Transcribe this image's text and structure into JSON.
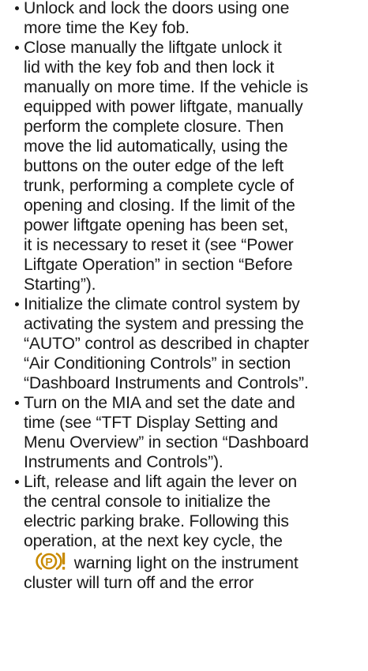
{
  "items": [
    {
      "lines": [
        "Unlock and lock the doors using one",
        "more time the Key fob."
      ]
    },
    {
      "lines": [
        "Close manually the liftgate unlock it",
        "lid with the key fob and then lock it",
        "manually on more time. If the vehicle is",
        "equipped with power liftgate, manually",
        "perform the complete closure. Then",
        "move the lid automatically, using the",
        "buttons on the outer edge of the left",
        "trunk, performing a complete cycle of",
        "opening and closing. If the limit of the",
        "power liftgate opening has been set,",
        "it is necessary to reset it (see “Power",
        "Liftgate Operation” in section “Before",
        "Starting”)."
      ]
    },
    {
      "lines": [
        "Initialize the climate control system by",
        "activating the system and pressing the",
        "“AUTO” control as described in chapter",
        "“Air Conditioning Controls” in section",
        "“Dashboard Instruments and Controls”."
      ]
    },
    {
      "lines": [
        "Turn on the MIA and set the date and",
        "time (see “TFT Display Setting and",
        "Menu Overview” in section “Dashboard",
        "Instruments and Controls”)."
      ]
    },
    {
      "lines": [
        "Lift, release and lift again the lever on",
        "the central console to initialize the",
        "electric parking brake. Following this",
        "operation, at the next key cycle, the"
      ],
      "icon_line_after": "warning light on the instrument",
      "icon": "parking-brake-warning-icon",
      "icon_color": "#c98a00",
      "lines_after": [
        "cluster will turn off and the error"
      ]
    }
  ]
}
